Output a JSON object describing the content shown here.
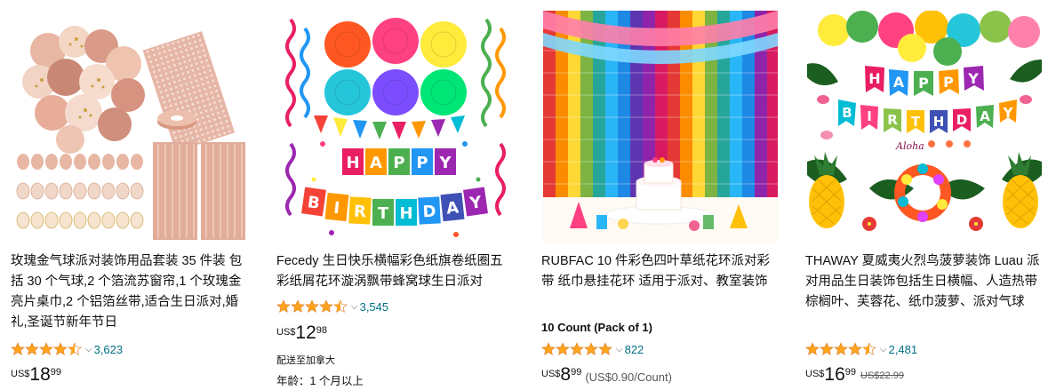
{
  "products": [
    {
      "title": "玫瑰金气球派对装饰用品套装 35 件装 包括 30 个气球,2 个箔流苏窗帘,1 个玫瑰金亮片桌巾,2 个铝箔丝带,适合生日派对,婚礼,圣诞节新年节日",
      "rating": 4.5,
      "review_count": "3,623",
      "price": {
        "currency": "US$",
        "whole": "18",
        "fraction": "99"
      },
      "image_icon": "rose-gold-balloon-set-image"
    },
    {
      "title": "Fecedy 生日快乐横幅彩色纸旗卷纸圈五彩纸屑花环漩涡飘带蜂窝球生日派对",
      "rating": 4.5,
      "review_count": "3,545",
      "price": {
        "currency": "US$",
        "whole": "12",
        "fraction": "98"
      },
      "shipping": "配送至加拿大",
      "age": "年龄：1 个月以上",
      "image_icon": "happy-birthday-banner-image",
      "banner_letters_top": [
        "H",
        "A",
        "P",
        "P",
        "Y"
      ],
      "banner_letters_bottom": [
        "B",
        "I",
        "R",
        "T",
        "H",
        "D",
        "A",
        "Y"
      ]
    },
    {
      "title": "RUBFAC 10 件彩色四叶草纸花环派对彩带 纸巾悬挂花环 适用于派对、教室装饰",
      "count_line": "10 Count (Pack of 1)",
      "rating": 5,
      "review_count": "822",
      "price": {
        "currency": "US$",
        "whole": "8",
        "fraction": "99",
        "unit_price": "(US$0.90/Count)"
      },
      "image_icon": "rainbow-garland-image"
    },
    {
      "title": "THAWAY 夏威夷火烈鸟菠萝装饰 Luau 派对用品生日装饰包括生日横幅、人造热带棕榈叶、芙蓉花、纸巾菠萝、派对气球",
      "rating": 4.5,
      "review_count": "2,481",
      "price": {
        "currency": "US$",
        "whole": "16",
        "fraction": "99",
        "list_price": "US$22.99"
      },
      "image_icon": "tropical-luau-party-image",
      "banner_letters_top": [
        "H",
        "A",
        "P",
        "P",
        "Y"
      ],
      "banner_letters_bottom": [
        "B",
        "I",
        "R",
        "T",
        "H",
        "D",
        "A",
        "Y"
      ],
      "aloha_text": "Aloha"
    }
  ],
  "colors": {
    "star": "#ffa41c",
    "link": "#007185",
    "text": "#0f1111",
    "muted": "#565959"
  }
}
